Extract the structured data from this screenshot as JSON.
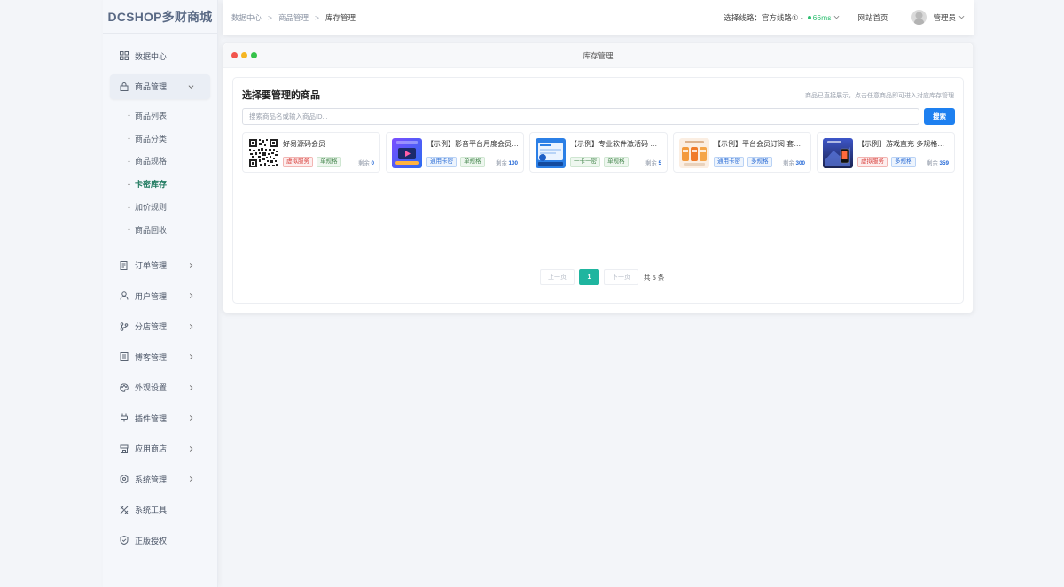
{
  "sidebar": {
    "logo": "DCSHOP多财商城",
    "items": [
      {
        "label": "数据中心",
        "icon": "dashboard-icon"
      },
      {
        "label": "商品管理",
        "icon": "bag-icon"
      },
      {
        "label": "订单管理",
        "icon": "order-icon"
      },
      {
        "label": "用户管理",
        "icon": "user-icon"
      },
      {
        "label": "分店管理",
        "icon": "branch-icon"
      },
      {
        "label": "博客管理",
        "icon": "blog-icon"
      },
      {
        "label": "外观设置",
        "icon": "palette-icon"
      },
      {
        "label": "插件管理",
        "icon": "plugin-icon"
      },
      {
        "label": "应用商店",
        "icon": "store-icon"
      },
      {
        "label": "系统管理",
        "icon": "settings-icon"
      },
      {
        "label": "系统工具",
        "icon": "tools-icon"
      },
      {
        "label": "正版授权",
        "icon": "shield-icon"
      }
    ],
    "sub_items": [
      "商品列表",
      "商品分类",
      "商品规格",
      "卡密库存",
      "加价规则",
      "商品回收"
    ],
    "sub_active": "卡密库存"
  },
  "header": {
    "breadcrumb": [
      "数据中心",
      "商品管理",
      "库存管理"
    ],
    "line_label": "选择线路：官方线路① -",
    "ping": "66ms",
    "home_link": "网站首页",
    "user": "管理员"
  },
  "window": {
    "title": "库存管理",
    "colors": {
      "red": "#f2554d",
      "yellow": "#f5b623",
      "green": "#35c249",
      "accent": "#1e80f0",
      "pager_active": "#1fb59f"
    },
    "card": {
      "title": "选择要管理的商品",
      "hint": "商品已直接展示，点击任意商品即可进入对应库存管理",
      "search_placeholder": "搜索商品名或输入商品ID...",
      "search_button": "搜索"
    },
    "goods": [
      {
        "name": "好易源码会员",
        "tags": [
          {
            "text": "虚拟服务",
            "kind": "red"
          },
          {
            "text": "单规格",
            "kind": "green"
          }
        ],
        "stock_label": "剩余",
        "stock": "0",
        "thumb": "qr"
      },
      {
        "name": "【示例】影音平台月度会员 演示卡密",
        "tags": [
          {
            "text": "通用卡密",
            "kind": "blue"
          },
          {
            "text": "单规格",
            "kind": "green"
          }
        ],
        "stock_label": "剩余",
        "stock": "100",
        "thumb": "video"
      },
      {
        "name": "【示例】专业软件激活码 演示卡密",
        "tags": [
          {
            "text": "一卡一密",
            "kind": "green"
          },
          {
            "text": "单规格",
            "kind": "green"
          }
        ],
        "stock_label": "剩余",
        "stock": "5",
        "thumb": "software"
      },
      {
        "name": "【示例】平台会员订阅 套餐多规格",
        "tags": [
          {
            "text": "通用卡密",
            "kind": "blue"
          },
          {
            "text": "多规格",
            "kind": "blue"
          }
        ],
        "stock_label": "剩余",
        "stock": "300",
        "thumb": "subscription"
      },
      {
        "name": "【示例】游戏直充 多规格演示",
        "tags": [
          {
            "text": "虚拟服务",
            "kind": "red"
          },
          {
            "text": "多规格",
            "kind": "blue"
          }
        ],
        "stock_label": "剩余",
        "stock": "359",
        "thumb": "game"
      }
    ],
    "pager": {
      "prev": "上一页",
      "page": "1",
      "next": "下一页",
      "total": "共 5 条"
    }
  }
}
